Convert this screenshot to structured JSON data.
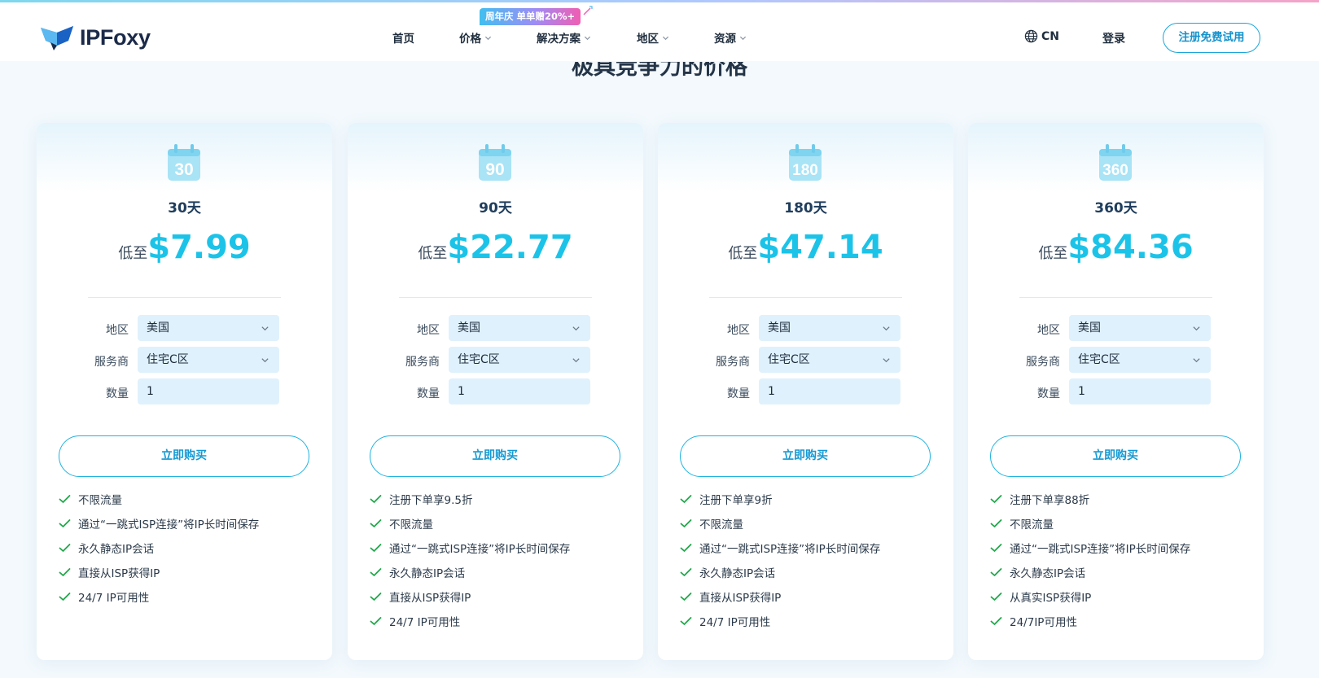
{
  "brand": {
    "name": "IPFoxy"
  },
  "nav": {
    "items": [
      {
        "label": "首页",
        "has_dropdown": false
      },
      {
        "label": "价格",
        "has_dropdown": true
      },
      {
        "label": "解决方案",
        "has_dropdown": true
      },
      {
        "label": "地区",
        "has_dropdown": true
      },
      {
        "label": "资源",
        "has_dropdown": true
      }
    ],
    "promo_badge": "周年庆 单单赠20%+",
    "language": "CN",
    "login": "登录",
    "signup": "注册免费试用"
  },
  "section_title": "极具竞争力的价格",
  "colors": {
    "accent": "#1cc3e8",
    "field_bg": "#dff1fc",
    "check": "#1fa84a",
    "border_blue": "#1aa6da"
  },
  "plans": [
    {
      "calendar_number": "30",
      "days": "30天",
      "price_prefix": "低至",
      "price": "$7.99",
      "fields": [
        {
          "label": "地区",
          "value": "美国",
          "type": "select"
        },
        {
          "label": "服务商",
          "value": "住宅C区",
          "type": "select"
        },
        {
          "label": "数量",
          "value": "1",
          "type": "input"
        }
      ],
      "buy_label": "立即购买",
      "features": [
        "不限流量",
        "通过“一跳式ISP连接”将IP长时间保存",
        "永久静态IP会话",
        "直接从ISP获得IP",
        "24/7 IP可用性"
      ]
    },
    {
      "calendar_number": "90",
      "days": "90天",
      "price_prefix": "低至",
      "price": "$22.77",
      "fields": [
        {
          "label": "地区",
          "value": "美国",
          "type": "select"
        },
        {
          "label": "服务商",
          "value": "住宅C区",
          "type": "select"
        },
        {
          "label": "数量",
          "value": "1",
          "type": "input"
        }
      ],
      "buy_label": "立即购买",
      "features": [
        "注册下单享9.5折",
        "不限流量",
        "通过“一跳式ISP连接”将IP长时间保存",
        "永久静态IP会话",
        "直接从ISP获得IP",
        "24/7 IP可用性"
      ]
    },
    {
      "calendar_number": "180",
      "days": "180天",
      "price_prefix": "低至",
      "price": "$47.14",
      "fields": [
        {
          "label": "地区",
          "value": "美国",
          "type": "select"
        },
        {
          "label": "服务商",
          "value": "住宅C区",
          "type": "select"
        },
        {
          "label": "数量",
          "value": "1",
          "type": "input"
        }
      ],
      "buy_label": "立即购买",
      "features": [
        "注册下单享9折",
        "不限流量",
        "通过“一跳式ISP连接”将IP长时间保存",
        "永久静态IP会话",
        "直接从ISP获得IP",
        "24/7 IP可用性"
      ]
    },
    {
      "calendar_number": "360",
      "days": "360天",
      "price_prefix": "低至",
      "price": "$84.36",
      "fields": [
        {
          "label": "地区",
          "value": "美国",
          "type": "select"
        },
        {
          "label": "服务商",
          "value": "住宅C区",
          "type": "select"
        },
        {
          "label": "数量",
          "value": "1",
          "type": "input"
        }
      ],
      "buy_label": "立即购买",
      "features": [
        "注册下单享88折",
        "不限流量",
        "通过“一跳式ISP连接”将IP长时间保存",
        "永久静态IP会话",
        "从真实ISP获得IP",
        "24/7IP可用性"
      ]
    }
  ]
}
